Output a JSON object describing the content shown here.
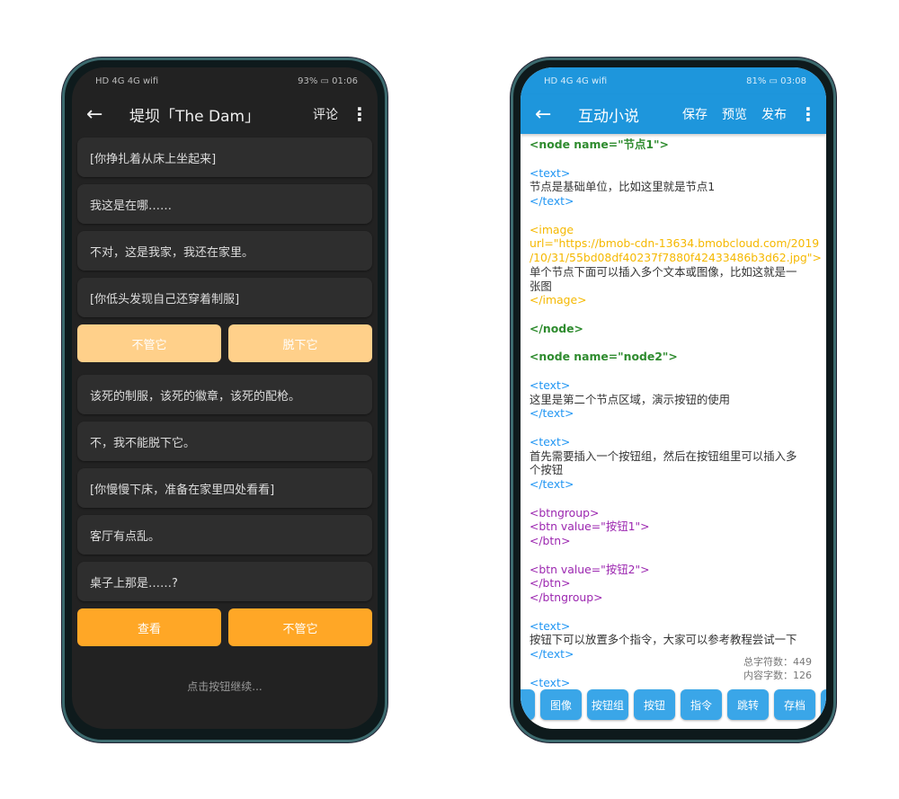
{
  "left": {
    "status": {
      "left": "HD 4G 4G wifi",
      "battery": "93%",
      "time": "01:06"
    },
    "title": "堤坝「The Dam」",
    "comment": "评论",
    "items": [
      {
        "type": "text",
        "text": "[你挣扎着从床上坐起来]"
      },
      {
        "type": "text",
        "text": "我这是在哪……"
      },
      {
        "type": "text",
        "text": "不对，这是我家，我还在家里。"
      },
      {
        "type": "text",
        "text": "[你低头发现自己还穿着制服]"
      },
      {
        "type": "buttons",
        "state": "faded",
        "labels": [
          "不管它",
          "脱下它"
        ]
      },
      {
        "type": "text",
        "text": "该死的制服，该死的徽章，该死的配枪。"
      },
      {
        "type": "text",
        "text": "不，我不能脱下它。"
      },
      {
        "type": "text",
        "text": "[你慢慢下床，准备在家里四处看看]"
      },
      {
        "type": "text",
        "text": "客厅有点乱。"
      },
      {
        "type": "text",
        "text": "桌子上那是……?"
      },
      {
        "type": "buttons",
        "state": "active",
        "labels": [
          "查看",
          "不管它"
        ]
      }
    ],
    "hint": "点击按钮继续..."
  },
  "right": {
    "status": {
      "left": "HD 4G 4G wifi",
      "battery": "81%",
      "time": "03:08"
    },
    "title": "互动小说",
    "actions": [
      "保存",
      "预览",
      "发布"
    ],
    "lines": [
      {
        "c": "node",
        "t": "<node name=\"节点1\">"
      },
      {
        "c": "body",
        "t": ""
      },
      {
        "c": "text",
        "t": "<text>"
      },
      {
        "c": "body",
        "t": "节点是基础单位，比如这里就是节点1"
      },
      {
        "c": "text",
        "t": "</text>"
      },
      {
        "c": "body",
        "t": ""
      },
      {
        "c": "img",
        "t": "<image"
      },
      {
        "c": "img",
        "t": "url=\"https://bmob-cdn-13634.bmobcloud.com/2019"
      },
      {
        "c": "img",
        "t": "/10/31/55bd08df40237f7880f42433486b3d62.jpg\">"
      },
      {
        "c": "body",
        "t": "单个节点下面可以插入多个文本或图像，比如这就是一"
      },
      {
        "c": "body",
        "t": "张图"
      },
      {
        "c": "img",
        "t": "</image>"
      },
      {
        "c": "body",
        "t": ""
      },
      {
        "c": "node",
        "t": "</node>"
      },
      {
        "c": "body",
        "t": ""
      },
      {
        "c": "node",
        "t": "<node name=\"node2\">"
      },
      {
        "c": "body",
        "t": ""
      },
      {
        "c": "text",
        "t": "<text>"
      },
      {
        "c": "body",
        "t": "这里是第二个节点区域，演示按钮的使用"
      },
      {
        "c": "text",
        "t": "</text>"
      },
      {
        "c": "body",
        "t": ""
      },
      {
        "c": "text",
        "t": "<text>"
      },
      {
        "c": "body",
        "t": "首先需要插入一个按钮组，然后在按钮组里可以插入多"
      },
      {
        "c": "body",
        "t": "个按钮"
      },
      {
        "c": "text",
        "t": "</text>"
      },
      {
        "c": "body",
        "t": ""
      },
      {
        "c": "btn",
        "t": "<btngroup>"
      },
      {
        "c": "btn",
        "t": "<btn value=\"按钮1\">"
      },
      {
        "c": "btn",
        "t": "</btn>"
      },
      {
        "c": "body",
        "t": ""
      },
      {
        "c": "btn",
        "t": "<btn value=\"按钮2\">"
      },
      {
        "c": "btn",
        "t": "</btn>"
      },
      {
        "c": "btn",
        "t": "</btngroup>"
      },
      {
        "c": "body",
        "t": ""
      },
      {
        "c": "text",
        "t": "<text>"
      },
      {
        "c": "body",
        "t": "按钮下可以放置多个指令，大家可以参考教程尝试一下"
      },
      {
        "c": "text",
        "t": "</text>"
      },
      {
        "c": "body",
        "t": ""
      },
      {
        "c": "text",
        "t": "<text>"
      }
    ],
    "total_chars": "总字符数：449",
    "content_chars": "内容字数：126",
    "toolbar": [
      "",
      "图像",
      "按钮组",
      "按钮",
      "指令",
      "跳转",
      "存档",
      ""
    ]
  }
}
